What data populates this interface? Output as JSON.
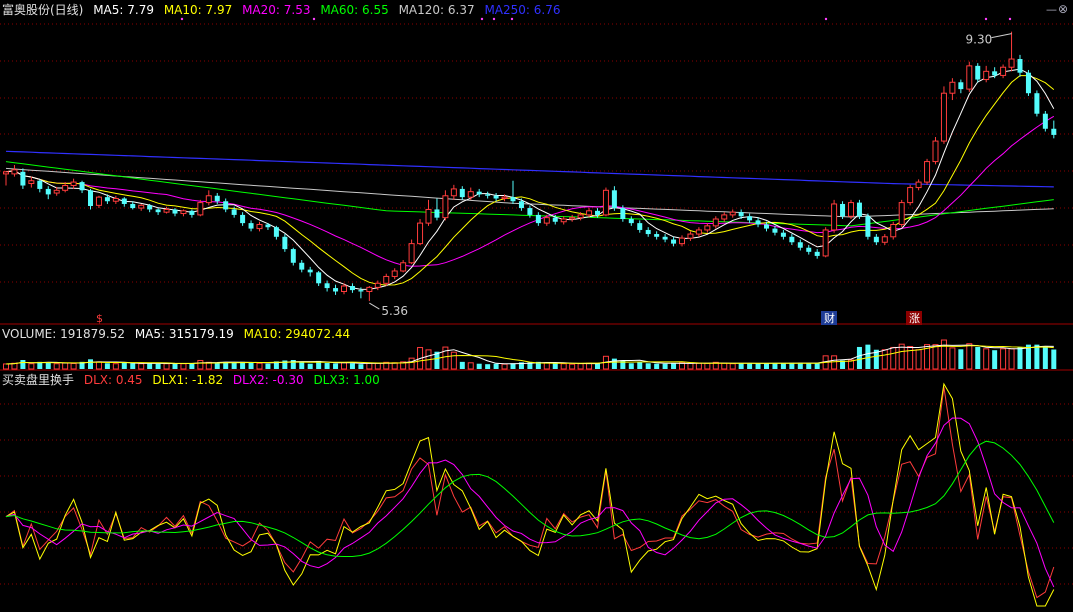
{
  "price_header": {
    "name": "富奥股份(日线)",
    "ma5": "MA5: 7.79",
    "ma10": "MA10: 7.97",
    "ma20": "MA20: 7.53",
    "ma60": "MA60: 6.55",
    "ma120": "MA120: 6.37",
    "ma250": "MA250: 6.76"
  },
  "volume_header": {
    "volume": "VOLUME: 191879.52",
    "ma5": "MA5: 315179.19",
    "ma10": "MA10: 294072.44"
  },
  "indicator_header": {
    "name": "买卖盘里换手",
    "dlx": "DLX: 0.45",
    "dlx1": "DLX1: -1.82",
    "dlx2": "DLX2: -0.30",
    "dlx3": "DLX3: 1.00"
  },
  "markers": {
    "high_label": "9.30",
    "low_label": "5.36",
    "event_dollar": "$",
    "event_cai": "财",
    "event_zhang": "涨"
  },
  "toolbar": {
    "minimize_icon": "minimize-icon",
    "close_icon": "close-icon"
  },
  "colors": {
    "ma5": "#ffffff",
    "ma10": "#ffff00",
    "ma20": "#ff00ff",
    "ma60": "#00ff00",
    "ma120": "#c8c8c8",
    "ma250": "#3030ff",
    "up": "#ff3c3c",
    "down": "#54fcfc",
    "grid": "#8b0000",
    "background": "#000000"
  },
  "chart_data": {
    "type": "candlestick",
    "series_price": {
      "count": 125,
      "high": 9.3,
      "low": 5.36,
      "candles": [
        [
          7.22,
          7.25,
          7.05,
          7.26
        ],
        [
          7.22,
          7.28,
          7.18,
          7.35
        ],
        [
          7.25,
          7.05,
          7.0,
          7.3
        ],
        [
          7.08,
          7.12,
          7.02,
          7.18
        ],
        [
          7.12,
          7.0,
          6.95,
          7.14
        ],
        [
          7.0,
          6.92,
          6.85,
          7.04
        ],
        [
          6.94,
          6.98,
          6.9,
          7.03
        ],
        [
          6.98,
          7.05,
          6.95,
          7.1
        ],
        [
          7.05,
          7.1,
          7.0,
          7.15
        ],
        [
          7.1,
          6.98,
          6.94,
          7.12
        ],
        [
          6.98,
          6.75,
          6.7,
          7.0
        ],
        [
          6.76,
          6.88,
          6.72,
          6.9
        ],
        [
          6.88,
          6.82,
          6.78,
          6.92
        ],
        [
          6.82,
          6.86,
          6.78,
          6.9
        ],
        [
          6.86,
          6.78,
          6.74,
          6.88
        ],
        [
          6.78,
          6.72,
          6.7,
          6.82
        ],
        [
          6.72,
          6.76,
          6.68,
          6.78
        ],
        [
          6.76,
          6.7,
          6.66,
          6.78
        ],
        [
          6.7,
          6.66,
          6.62,
          6.72
        ],
        [
          6.66,
          6.7,
          6.64,
          6.74
        ],
        [
          6.7,
          6.64,
          6.6,
          6.72
        ],
        [
          6.64,
          6.68,
          6.6,
          6.7
        ],
        [
          6.68,
          6.62,
          6.58,
          6.7
        ],
        [
          6.62,
          6.8,
          6.6,
          6.84
        ],
        [
          6.8,
          6.9,
          6.76,
          6.98
        ],
        [
          6.9,
          6.82,
          6.78,
          6.94
        ],
        [
          6.82,
          6.7,
          6.66,
          6.86
        ],
        [
          6.7,
          6.62,
          6.58,
          6.74
        ],
        [
          6.62,
          6.5,
          6.46,
          6.66
        ],
        [
          6.5,
          6.42,
          6.38,
          6.54
        ],
        [
          6.42,
          6.48,
          6.38,
          6.52
        ],
        [
          6.48,
          6.44,
          6.4,
          6.5
        ],
        [
          6.44,
          6.3,
          6.26,
          6.46
        ],
        [
          6.3,
          6.12,
          6.08,
          6.34
        ],
        [
          6.12,
          5.92,
          5.88,
          6.14
        ],
        [
          5.92,
          5.82,
          5.78,
          5.96
        ],
        [
          5.82,
          5.78,
          5.72,
          5.86
        ],
        [
          5.78,
          5.62,
          5.58,
          5.8
        ],
        [
          5.62,
          5.55,
          5.5,
          5.66
        ],
        [
          5.55,
          5.5,
          5.45,
          5.6
        ],
        [
          5.5,
          5.58,
          5.46,
          5.62
        ],
        [
          5.58,
          5.52,
          5.48,
          5.62
        ],
        [
          5.52,
          5.5,
          5.4,
          5.56
        ],
        [
          5.5,
          5.56,
          5.36,
          5.58
        ],
        [
          5.56,
          5.62,
          5.52,
          5.66
        ],
        [
          5.62,
          5.72,
          5.58,
          5.76
        ],
        [
          5.72,
          5.8,
          5.68,
          5.84
        ],
        [
          5.8,
          5.92,
          5.78,
          5.96
        ],
        [
          5.92,
          6.2,
          5.9,
          6.26
        ],
        [
          6.2,
          6.5,
          6.18,
          6.56
        ],
        [
          6.5,
          6.7,
          6.46,
          6.84
        ],
        [
          6.7,
          6.58,
          6.54,
          6.86
        ],
        [
          6.58,
          6.9,
          6.54,
          6.98
        ],
        [
          6.9,
          7.0,
          6.84,
          7.06
        ],
        [
          7.0,
          6.88,
          6.84,
          7.04
        ],
        [
          6.88,
          6.96,
          6.84,
          7.02
        ],
        [
          6.96,
          6.92,
          6.88,
          7.0
        ],
        [
          6.92,
          6.9,
          6.86,
          6.96
        ],
        [
          6.9,
          6.86,
          6.82,
          6.94
        ],
        [
          6.86,
          6.88,
          6.82,
          6.92
        ],
        [
          6.88,
          6.82,
          6.78,
          7.12
        ],
        [
          6.82,
          6.72,
          6.68,
          6.86
        ],
        [
          6.72,
          6.62,
          6.58,
          6.76
        ],
        [
          6.62,
          6.5,
          6.46,
          6.66
        ],
        [
          6.5,
          6.58,
          6.46,
          6.62
        ],
        [
          6.58,
          6.52,
          6.48,
          6.62
        ],
        [
          6.52,
          6.56,
          6.48,
          6.6
        ],
        [
          6.56,
          6.58,
          6.52,
          6.62
        ],
        [
          6.58,
          6.62,
          6.54,
          6.66
        ],
        [
          6.62,
          6.68,
          6.58,
          6.72
        ],
        [
          6.68,
          6.62,
          6.58,
          6.72
        ],
        [
          6.62,
          6.98,
          6.6,
          7.02
        ],
        [
          6.98,
          6.72,
          6.68,
          7.04
        ],
        [
          6.72,
          6.56,
          6.52,
          6.76
        ],
        [
          6.56,
          6.5,
          6.46,
          6.6
        ],
        [
          6.5,
          6.4,
          6.36,
          6.54
        ],
        [
          6.4,
          6.34,
          6.3,
          6.44
        ],
        [
          6.34,
          6.3,
          6.26,
          6.38
        ],
        [
          6.3,
          6.26,
          6.22,
          6.34
        ],
        [
          6.26,
          6.2,
          6.16,
          6.3
        ],
        [
          6.2,
          6.28,
          6.16,
          6.32
        ],
        [
          6.28,
          6.34,
          6.24,
          6.38
        ],
        [
          6.34,
          6.4,
          6.3,
          6.44
        ],
        [
          6.4,
          6.46,
          6.36,
          6.5
        ],
        [
          6.46,
          6.56,
          6.42,
          6.6
        ],
        [
          6.56,
          6.62,
          6.52,
          6.66
        ],
        [
          6.62,
          6.66,
          6.58,
          6.7
        ],
        [
          6.66,
          6.6,
          6.56,
          6.7
        ],
        [
          6.6,
          6.54,
          6.5,
          6.64
        ],
        [
          6.54,
          6.48,
          6.44,
          6.58
        ],
        [
          6.48,
          6.42,
          6.38,
          6.52
        ],
        [
          6.42,
          6.36,
          6.32,
          6.46
        ],
        [
          6.36,
          6.3,
          6.26,
          6.4
        ],
        [
          6.3,
          6.22,
          6.18,
          6.34
        ],
        [
          6.22,
          6.14,
          6.1,
          6.26
        ],
        [
          6.14,
          6.08,
          6.04,
          6.18
        ],
        [
          6.08,
          6.02,
          5.98,
          6.12
        ],
        [
          6.02,
          6.4,
          6.0,
          6.44
        ],
        [
          6.4,
          6.78,
          6.36,
          6.84
        ],
        [
          6.78,
          6.6,
          6.56,
          6.82
        ],
        [
          6.6,
          6.8,
          6.56,
          6.84
        ],
        [
          6.8,
          6.6,
          6.56,
          6.84
        ],
        [
          6.6,
          6.3,
          6.26,
          6.64
        ],
        [
          6.3,
          6.22,
          6.18,
          6.34
        ],
        [
          6.22,
          6.3,
          6.18,
          6.34
        ],
        [
          6.3,
          6.48,
          6.26,
          6.52
        ],
        [
          6.48,
          6.8,
          6.44,
          6.84
        ],
        [
          6.8,
          7.02,
          6.76,
          7.06
        ],
        [
          7.02,
          7.1,
          6.98,
          7.14
        ],
        [
          7.1,
          7.4,
          7.06,
          7.44
        ],
        [
          7.4,
          7.7,
          7.36,
          7.76
        ],
        [
          7.7,
          8.4,
          7.66,
          8.5
        ],
        [
          8.4,
          8.56,
          8.3,
          8.62
        ],
        [
          8.56,
          8.46,
          8.4,
          8.6
        ],
        [
          8.46,
          8.8,
          8.42,
          8.86
        ],
        [
          8.8,
          8.6,
          8.56,
          8.84
        ],
        [
          8.6,
          8.72,
          8.56,
          8.8
        ],
        [
          8.72,
          8.66,
          8.62,
          8.78
        ],
        [
          8.66,
          8.78,
          8.62,
          8.82
        ],
        [
          8.78,
          8.9,
          8.72,
          9.3
        ],
        [
          8.9,
          8.7,
          8.64,
          8.96
        ],
        [
          8.7,
          8.4,
          8.36,
          8.74
        ],
        [
          8.4,
          8.1,
          8.06,
          8.44
        ],
        [
          8.1,
          7.88,
          7.84,
          8.14
        ],
        [
          7.88,
          7.79,
          7.74,
          8.0
        ]
      ]
    },
    "series_volume_note": "bars colored by candle direction",
    "ylim_price": [
      5.2,
      9.5
    ]
  }
}
